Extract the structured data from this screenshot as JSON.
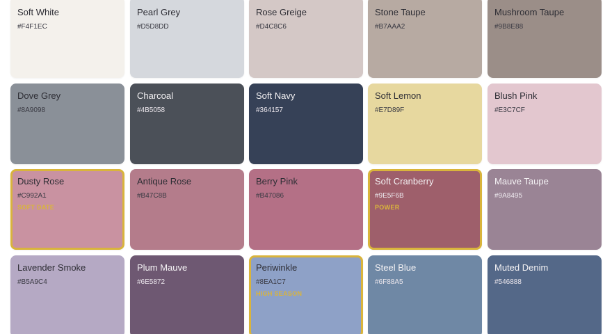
{
  "accent_color": "#d9b43c",
  "swatches": [
    {
      "name": "Soft White",
      "hex": "#F4F1EC",
      "color": "#F4F1EC",
      "text": "light",
      "selected": false,
      "tag": ""
    },
    {
      "name": "Pearl Grey",
      "hex": "#D5D8DD",
      "color": "#D5D8DD",
      "text": "light",
      "selected": false,
      "tag": ""
    },
    {
      "name": "Rose Greige",
      "hex": "#D4C8C6",
      "color": "#D4C8C6",
      "text": "light",
      "selected": false,
      "tag": ""
    },
    {
      "name": "Stone Taupe",
      "hex": "#B7AAA2",
      "color": "#B7AAA2",
      "text": "light",
      "selected": false,
      "tag": ""
    },
    {
      "name": "Mushroom Taupe",
      "hex": "#9B8E88",
      "color": "#9B8E88",
      "text": "light",
      "selected": false,
      "tag": ""
    },
    {
      "name": "Dove Grey",
      "hex": "#8A9098",
      "color": "#8A9098",
      "text": "light",
      "selected": false,
      "tag": ""
    },
    {
      "name": "Charcoal",
      "hex": "#4B5058",
      "color": "#4B5058",
      "text": "dark",
      "selected": false,
      "tag": ""
    },
    {
      "name": "Soft Navy",
      "hex": "#364157",
      "color": "#364157",
      "text": "dark",
      "selected": false,
      "tag": ""
    },
    {
      "name": "Soft Lemon",
      "hex": "#E7D89F",
      "color": "#E7D89F",
      "text": "light",
      "selected": false,
      "tag": ""
    },
    {
      "name": "Blush Pink",
      "hex": "#E3C7CF",
      "color": "#E3C7CF",
      "text": "light",
      "selected": false,
      "tag": ""
    },
    {
      "name": "Dusty Rose",
      "hex": "#C992A1",
      "color": "#C992A1",
      "text": "light",
      "selected": true,
      "tag": "SOFT DATE"
    },
    {
      "name": "Antique Rose",
      "hex": "#B47C8B",
      "color": "#B47C8B",
      "text": "light",
      "selected": false,
      "tag": ""
    },
    {
      "name": "Berry Pink",
      "hex": "#B47086",
      "color": "#B47086",
      "text": "light",
      "selected": false,
      "tag": ""
    },
    {
      "name": "Soft Cranberry",
      "hex": "#9E5F6B",
      "color": "#9E5F6B",
      "text": "dark",
      "selected": true,
      "tag": "POWER"
    },
    {
      "name": "Mauve Taupe",
      "hex": "#9A8495",
      "color": "#9A8495",
      "text": "dark",
      "selected": false,
      "tag": ""
    },
    {
      "name": "Lavender Smoke",
      "hex": "#B5A9C4",
      "color": "#B5A9C4",
      "text": "light",
      "selected": false,
      "tag": ""
    },
    {
      "name": "Plum Mauve",
      "hex": "#6E5872",
      "color": "#6E5872",
      "text": "dark",
      "selected": false,
      "tag": ""
    },
    {
      "name": "Periwinkle",
      "hex": "#8EA1C7",
      "color": "#8EA1C7",
      "text": "light",
      "selected": true,
      "tag": "HIGH SEASON"
    },
    {
      "name": "Steel Blue",
      "hex": "#6F88A5",
      "color": "#6F88A5",
      "text": "dark",
      "selected": false,
      "tag": ""
    },
    {
      "name": "Muted Denim",
      "hex": "#546888",
      "color": "#546888",
      "text": "dark",
      "selected": false,
      "tag": ""
    }
  ]
}
